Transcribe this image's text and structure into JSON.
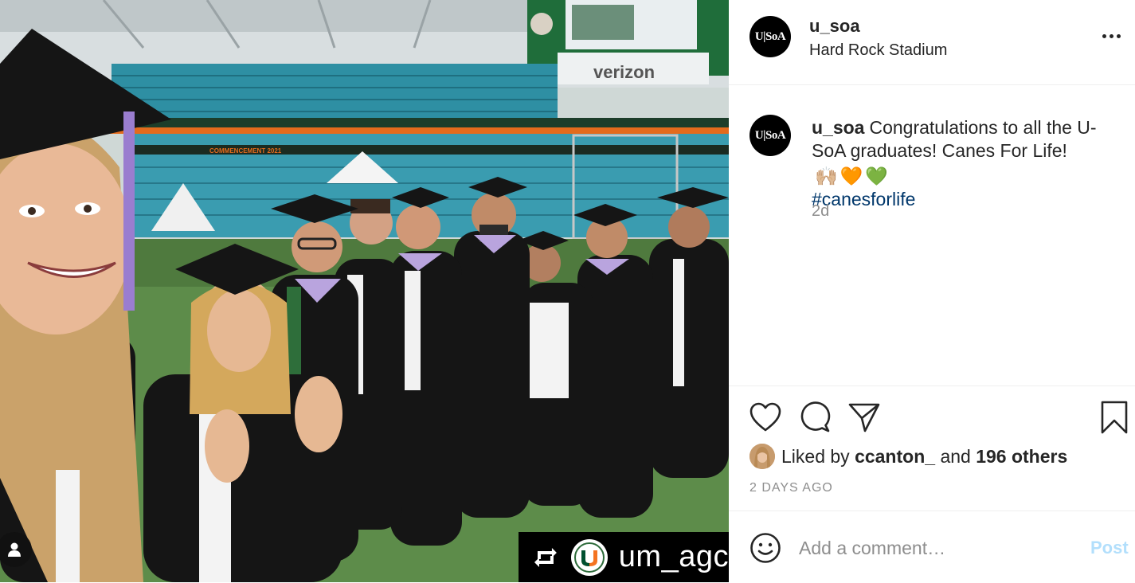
{
  "photo": {
    "signage": {
      "sponsor": "verizon",
      "banner": "COMMENCEMENT 2021"
    },
    "repost": {
      "icon": "repost-icon",
      "handle": "um_agc"
    },
    "tag_icon": "user-tag-icon"
  },
  "header": {
    "avatar_text": "U|SoA",
    "username": "u_soa",
    "location": "Hard Rock Stadium",
    "more_icon": "more-options-icon"
  },
  "caption": {
    "avatar_text": "U|SoA",
    "username": "u_soa",
    "text": "Congratulations to all the U-SoA graduates! Canes For Life!",
    "emojis": [
      "🙌🏼",
      "🧡",
      "💚"
    ],
    "hashtag": "#canesforlife",
    "age": "2d"
  },
  "actions": {
    "like_icon": "heart-icon",
    "comment_icon": "comment-icon",
    "share_icon": "share-icon",
    "save_icon": "bookmark-icon"
  },
  "likes": {
    "prefix": "Liked by",
    "user": "ccanton_",
    "joiner": "and",
    "others": "196 others"
  },
  "timestamp": "2 DAYS AGO",
  "comment": {
    "placeholder": "Add a comment…",
    "post_label": "Post",
    "emoji_icon": "smiley-icon"
  },
  "colors": {
    "link": "#00376b",
    "muted": "#8e8e8e",
    "post_disabled": "#b2dffc",
    "gown": "#151515",
    "seats": "#2e8fa3",
    "grass": "#5d8c4a"
  }
}
